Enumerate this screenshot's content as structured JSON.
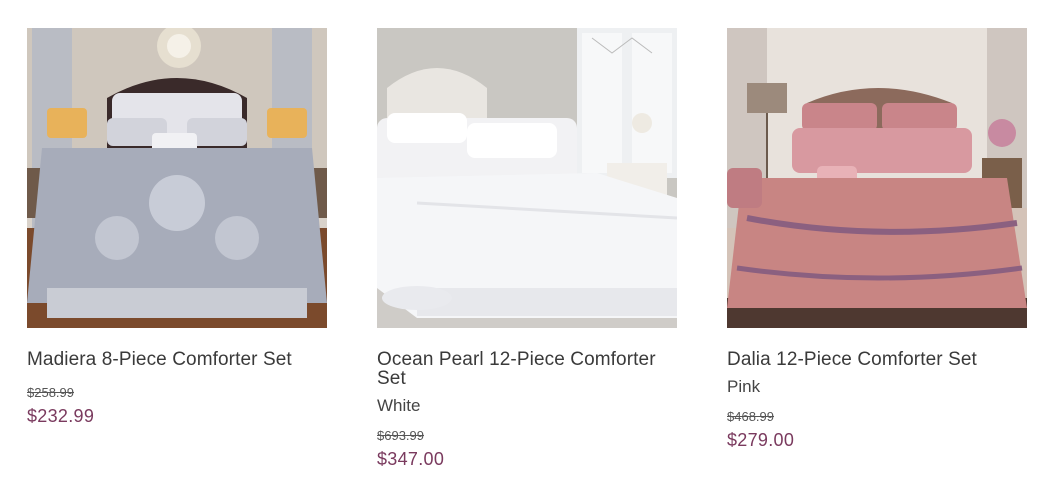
{
  "products": [
    {
      "name": "Madiera 8-Piece Comforter Set",
      "variant": "",
      "original_price": "$258.99",
      "sale_price": "$232.99",
      "image_icon": "bed-product-photo-gray"
    },
    {
      "name": "Ocean Pearl 12-Piece Comforter Set",
      "variant": "White",
      "original_price": "$693.99",
      "sale_price": "$347.00",
      "image_icon": "bed-product-photo-white"
    },
    {
      "name": "Dalia 12-Piece Comforter Set",
      "variant": "Pink",
      "original_price": "$468.99",
      "sale_price": "$279.00",
      "image_icon": "bed-product-photo-pink"
    }
  ],
  "colors": {
    "sale_price": "#7a3a5e",
    "name_text": "#3a3a3a"
  }
}
